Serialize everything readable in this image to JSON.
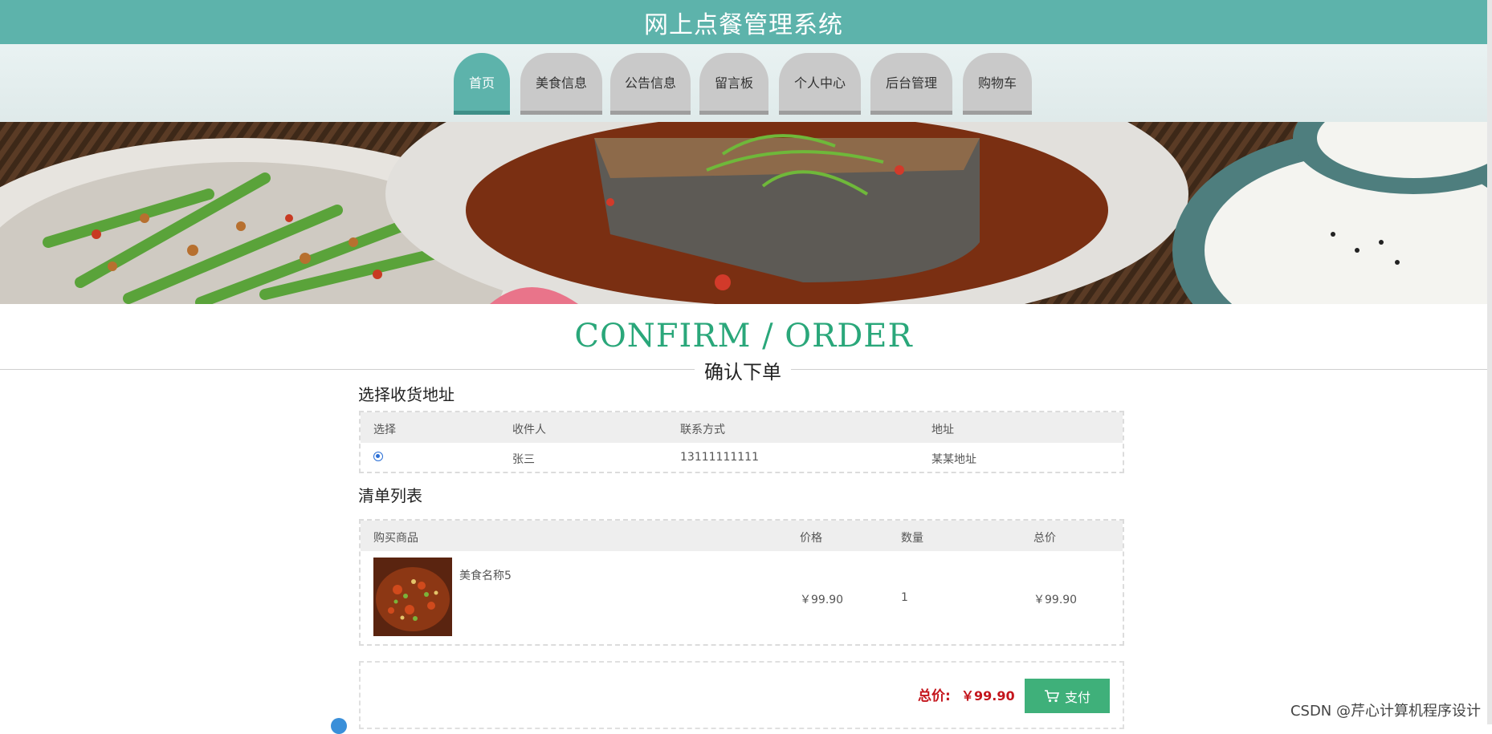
{
  "header": {
    "title": "网上点餐管理系统"
  },
  "nav": {
    "tabs": [
      {
        "label": "首页",
        "active": true
      },
      {
        "label": "美食信息",
        "active": false
      },
      {
        "label": "公告信息",
        "active": false
      },
      {
        "label": "留言板",
        "active": false
      },
      {
        "label": "个人中心",
        "active": false
      },
      {
        "label": "后台管理",
        "active": false
      },
      {
        "label": "购物车",
        "active": false
      }
    ]
  },
  "page": {
    "title_en": "CONFIRM / ORDER",
    "title_cn": "确认下单"
  },
  "address": {
    "section_title": "选择收货地址",
    "columns": [
      "选择",
      "收件人",
      "联系方式",
      "地址"
    ],
    "rows": [
      {
        "selected": true,
        "recipient": "张三",
        "phone": "13111111111",
        "address": "某某地址"
      }
    ]
  },
  "order": {
    "section_title": "清单列表",
    "columns": [
      "购买商品",
      "价格",
      "数量",
      "总价"
    ],
    "items": [
      {
        "name": "美食名称5",
        "price": "￥99.90",
        "quantity": "1",
        "subtotal": "￥99.90"
      }
    ]
  },
  "summary": {
    "total_label": "总价:",
    "total_value": "￥99.90",
    "pay_label": "支付"
  },
  "watermark": "CSDN @芹心计算机程序设计",
  "colors": {
    "primary": "#5db3ab",
    "accent_green": "#3fb07a",
    "price_red": "#c4151c",
    "title_green": "#2aa77a"
  }
}
